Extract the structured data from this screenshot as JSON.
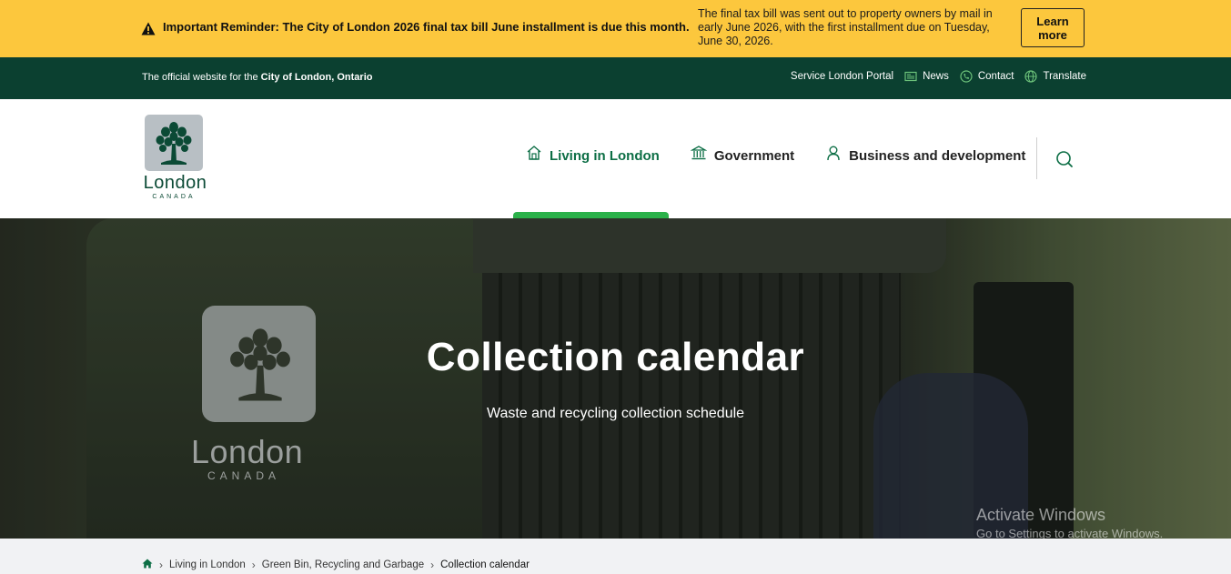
{
  "alert": {
    "title": "Important Reminder: The City of London 2026 final tax bill June installment is due this month.",
    "body": "The final tax bill was sent out to property owners by mail in early June 2026, with the first installment due on Tuesday, June 30, 2026.",
    "button_label": "Learn more",
    "icon": "warning-icon",
    "background_color": "#fcc73d"
  },
  "utility": {
    "official_prefix": "The official website for the",
    "official_strong": "City of London, Ontario",
    "links": [
      {
        "label": "Service London Portal",
        "icon": ""
      },
      {
        "label": "News",
        "icon": "newspaper-icon"
      },
      {
        "label": "Contact",
        "icon": "phone-icon"
      },
      {
        "label": "Translate",
        "icon": "globe-icon"
      }
    ],
    "background_color": "#0b4030"
  },
  "header": {
    "logo_word": "London",
    "logo_sub": "CANADA",
    "nav": [
      {
        "label": "Living in London",
        "icon": "house-icon",
        "active": true
      },
      {
        "label": "Government",
        "icon": "building-icon",
        "active": false
      },
      {
        "label": "Business and development",
        "icon": "person-icon",
        "active": false
      }
    ],
    "search_icon": "search-icon",
    "accent_color": "#2bb14a"
  },
  "hero": {
    "title": "Collection calendar",
    "subtitle": "Waste and recycling collection schedule",
    "bin_logo_word": "London",
    "bin_logo_sub": "CANADA"
  },
  "watermark": {
    "line1": "Activate Windows",
    "line2": "Go to Settings to activate Windows."
  },
  "breadcrumb": {
    "home_icon": "home-icon",
    "items": [
      "Living in London",
      "Green Bin, Recycling and Garbage"
    ],
    "current": "Collection calendar"
  }
}
